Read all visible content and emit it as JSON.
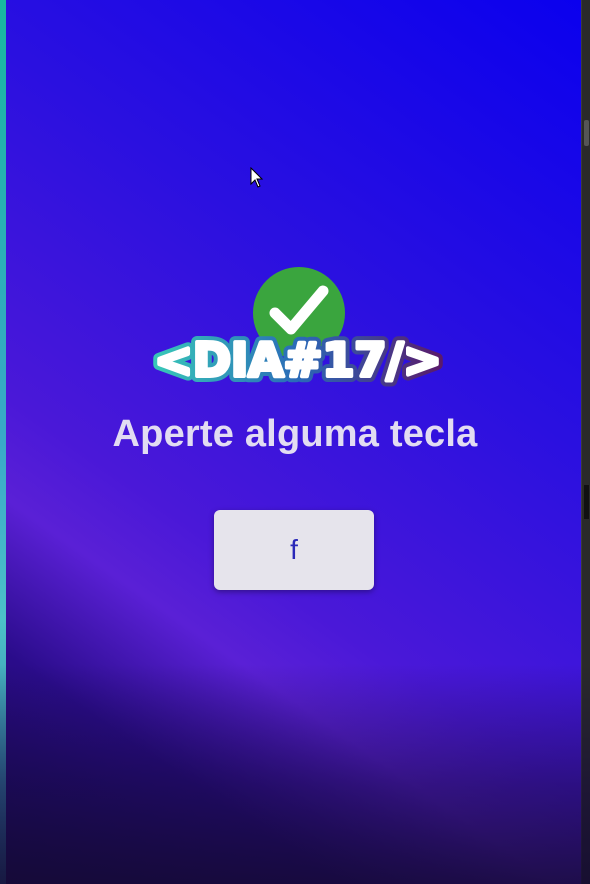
{
  "logo": {
    "text": "<DIA#17/>"
  },
  "badge": {
    "icon": "checkmark-icon"
  },
  "instruction": {
    "text": "Aperte alguma tecla"
  },
  "key_display": {
    "value": "f"
  },
  "colors": {
    "background_top": "#0a00ee",
    "background_mid": "#4a18d8",
    "badge_green": "#3aa53e",
    "key_text": "#2a28b8",
    "headline": "#e2dcf2"
  },
  "cursor": {
    "icon": "mouse-pointer-icon"
  }
}
